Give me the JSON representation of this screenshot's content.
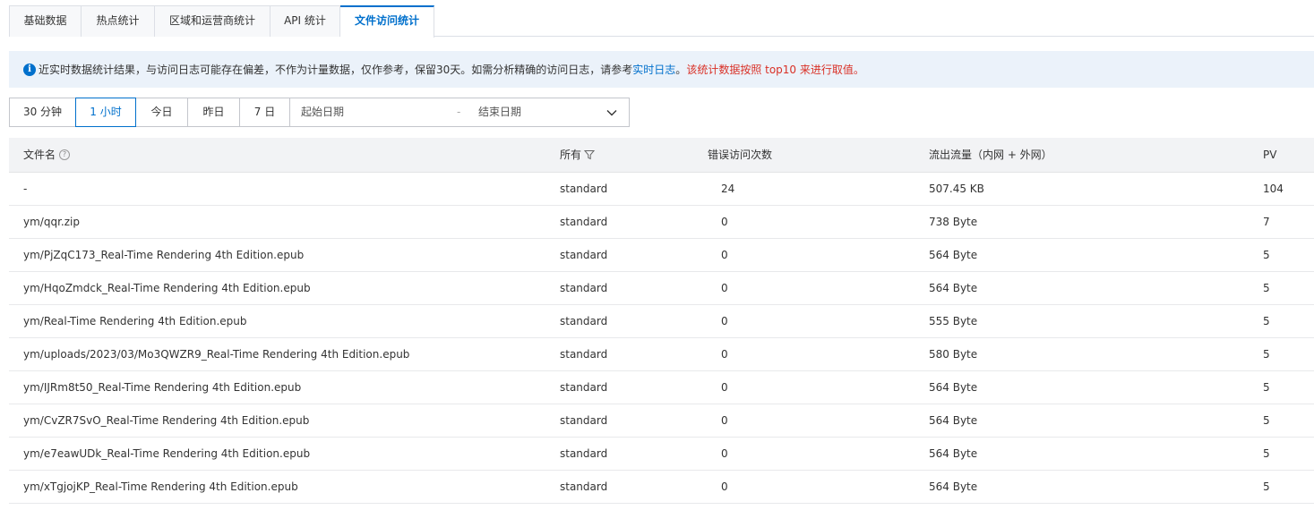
{
  "tabs": [
    {
      "label": "基础数据",
      "active": false
    },
    {
      "label": "热点统计",
      "active": false
    },
    {
      "label": "区域和运营商统计",
      "active": false
    },
    {
      "label": "API 统计",
      "active": false
    },
    {
      "label": "文件访问统计",
      "active": true
    }
  ],
  "notice": {
    "text": "近实时数据统计结果，与访问日志可能存在偏差，不作为计量数据，仅作参考，保留30天。如需分析精确的访问日志，请参考",
    "link": "实时日志",
    "period": "。",
    "warning": "该统计数据按照 top10 来进行取值。"
  },
  "time_filter": {
    "options": [
      "30 分钟",
      "1 小时",
      "今日",
      "昨日",
      "7 日"
    ],
    "active": "1 小时",
    "start_placeholder": "起始日期",
    "separator": "-",
    "end_placeholder": "结束日期"
  },
  "table": {
    "headers": {
      "filename": "文件名",
      "storage": "所有",
      "errors": "错误访问次数",
      "traffic": "流出流量（内网 + 外网）",
      "pv": "PV"
    },
    "rows": [
      {
        "filename": "-",
        "storage": "standard",
        "errors": "24",
        "traffic": "507.45 KB",
        "pv": "104"
      },
      {
        "filename": "ym/qqr.zip",
        "storage": "standard",
        "errors": "0",
        "traffic": "738 Byte",
        "pv": "7"
      },
      {
        "filename": "ym/PjZqC173_Real-Time Rendering 4th Edition.epub",
        "storage": "standard",
        "errors": "0",
        "traffic": "564 Byte",
        "pv": "5"
      },
      {
        "filename": "ym/HqoZmdck_Real-Time Rendering 4th Edition.epub",
        "storage": "standard",
        "errors": "0",
        "traffic": "564 Byte",
        "pv": "5"
      },
      {
        "filename": "ym/Real-Time Rendering 4th Edition.epub",
        "storage": "standard",
        "errors": "0",
        "traffic": "555 Byte",
        "pv": "5"
      },
      {
        "filename": "ym/uploads/2023/03/Mo3QWZR9_Real-Time Rendering 4th Edition.epub",
        "storage": "standard",
        "errors": "0",
        "traffic": "580 Byte",
        "pv": "5"
      },
      {
        "filename": "ym/IJRm8t50_Real-Time Rendering 4th Edition.epub",
        "storage": "standard",
        "errors": "0",
        "traffic": "564 Byte",
        "pv": "5"
      },
      {
        "filename": "ym/CvZR7SvO_Real-Time Rendering 4th Edition.epub",
        "storage": "standard",
        "errors": "0",
        "traffic": "564 Byte",
        "pv": "5"
      },
      {
        "filename": "ym/e7eawUDk_Real-Time Rendering 4th Edition.epub",
        "storage": "standard",
        "errors": "0",
        "traffic": "564 Byte",
        "pv": "5"
      },
      {
        "filename": "ym/xTgjojKP_Real-Time Rendering 4th Edition.epub",
        "storage": "standard",
        "errors": "0",
        "traffic": "564 Byte",
        "pv": "5"
      }
    ]
  },
  "colors": {
    "accent": "#0070cc",
    "warning": "#d93026",
    "notice_bg": "#ebf2fa",
    "header_bg": "#f2f3f5"
  },
  "icons": {
    "notice": "info-icon",
    "filename_header": "help-icon",
    "storage_header": "filter-icon",
    "date_picker": "chevron-down-icon"
  }
}
